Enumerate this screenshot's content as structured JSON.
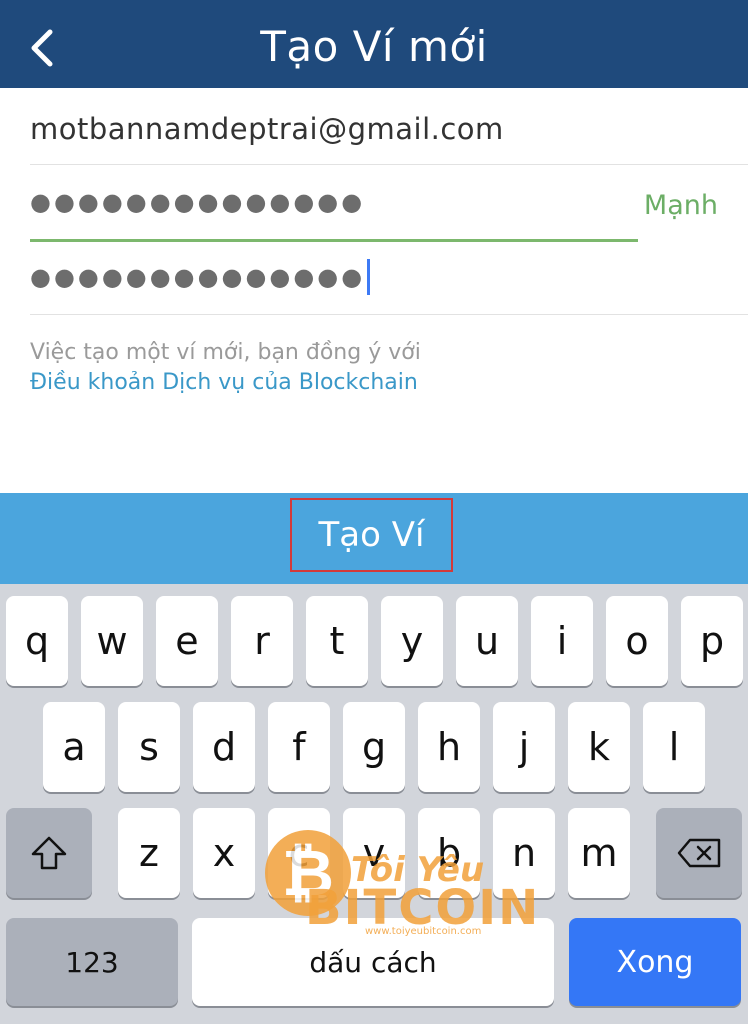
{
  "header": {
    "back_icon": "chevron-left-icon",
    "title": "Tạo Ví mới"
  },
  "form": {
    "email_value": "motbannamdeptrai@gmail.com",
    "password_mask": "●●●●●●●●●●●●●●",
    "password_strength": "Mạnh",
    "confirm_mask": "●●●●●●●●●●●●●●",
    "terms_intro": "Việc tạo một ví mới, bạn đồng ý với",
    "terms_link": "Điều khoản Dịch vụ của Blockchain"
  },
  "create_button": {
    "label": "Tạo Ví"
  },
  "keyboard": {
    "row1": [
      "q",
      "w",
      "e",
      "r",
      "t",
      "y",
      "u",
      "i",
      "o",
      "p"
    ],
    "row2": [
      "a",
      "s",
      "d",
      "f",
      "g",
      "h",
      "j",
      "k",
      "l"
    ],
    "row3": [
      "z",
      "x",
      "c",
      "v",
      "b",
      "n",
      "m"
    ],
    "numbers_label": "123",
    "space_label": "dấu cách",
    "done_label": "Xong",
    "shift_icon": "shift-icon",
    "backspace_icon": "backspace-icon"
  },
  "watermark": {
    "line1": "Tôi Yêu",
    "line2": "BITCOIN",
    "url": "www.toiyeubitcoin.com"
  },
  "colors": {
    "header_bg": "#1f4a7c",
    "create_bar_bg": "#4ba5dd",
    "strength_green": "#6cae66",
    "link_blue": "#3a98c8",
    "done_key_blue": "#3477f6"
  }
}
